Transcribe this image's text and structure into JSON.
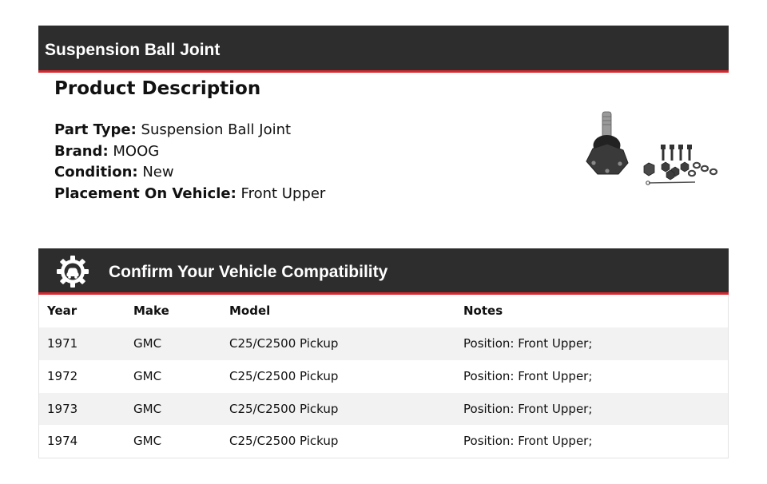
{
  "header": {
    "title": "Suspension Ball Joint"
  },
  "description": {
    "heading": "Product Description",
    "specs": [
      {
        "label": "Part Type:",
        "value": "Suspension Ball Joint"
      },
      {
        "label": "Brand:",
        "value": "MOOG"
      },
      {
        "label": "Condition:",
        "value": "New"
      },
      {
        "label": "Placement On Vehicle:",
        "value": "Front Upper"
      }
    ]
  },
  "compatibility": {
    "title": "Confirm Your Vehicle Compatibility",
    "icon": "gear-car-icon",
    "columns": [
      "Year",
      "Make",
      "Model",
      "Notes"
    ],
    "rows": [
      [
        "1971",
        "GMC",
        "C25/C2500 Pickup",
        "Position: Front Upper;"
      ],
      [
        "1972",
        "GMC",
        "C25/C2500 Pickup",
        "Position: Front Upper;"
      ],
      [
        "1973",
        "GMC",
        "C25/C2500 Pickup",
        "Position: Front Upper;"
      ],
      [
        "1974",
        "GMC",
        "C25/C2500 Pickup",
        "Position: Front Upper;"
      ]
    ]
  },
  "colors": {
    "header_bg": "#2e2d2d",
    "accent": "#d9262f",
    "row_shade": "#f2f2f2"
  }
}
